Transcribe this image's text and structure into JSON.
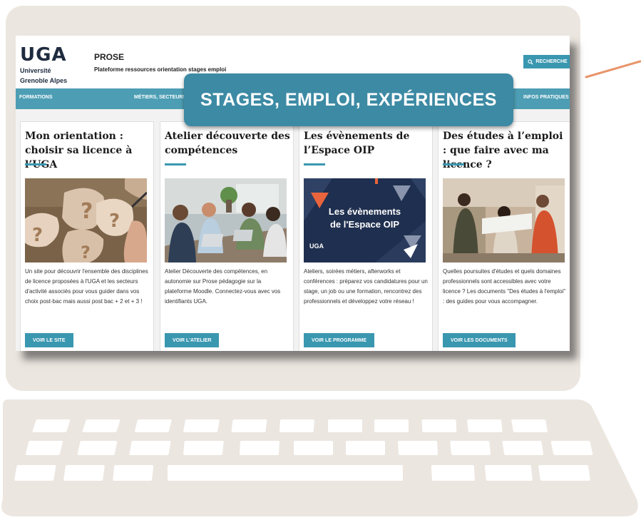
{
  "header": {
    "logo_text": "UGA",
    "logo_sub_1": "Université",
    "logo_sub_2": "Grenoble Alpes",
    "title": "PROSE",
    "subtitle": "Plateforme ressources orientation stages emploi",
    "search_label": "RECHERCHE"
  },
  "nav": {
    "items": [
      "FORMATIONS",
      "MÉTIERS, SECTEURS",
      "INFOS PRATIQUES"
    ]
  },
  "banner": {
    "text": "STAGES, EMPLOI, EXPÉRIENCES"
  },
  "cards": [
    {
      "title": "Mon orientation : choisir sa licence à l’UGA",
      "description": "Un site pour découvrir l'ensemble des disciplines de licence proposées à l'UGA et les secteurs d'activité associés pour vous guider dans vos choix post-bac mais aussi post bac + 2 et + 3 !",
      "button": "VOIR LE SITE"
    },
    {
      "title": "Atelier découverte des compétences",
      "description": "Atelier Découverte des compétences, en autonomie sur Prose pédagogie sur la plateforme Moodle. Connectez-vous avec vos identifiants UGA.",
      "button": "VOIR L'ATELIER"
    },
    {
      "title": "Les évènements de l’Espace OIP",
      "description": "Ateliers, soirées métiers, afterworks et conférences : préparez vos candidatures pour un stage, un job ou une formation, rencontrez des professionnels et développez votre réseau !",
      "button": "VOIR LE PROGRAMME",
      "image_text_1": "Les évènements",
      "image_text_2": "de l'Espace OIP",
      "image_logo": "UGA"
    },
    {
      "title": "Des études à l’emploi : que faire avec ma licence ?",
      "description": "Quelles poursuites d'études et quels domaines professionnels sont accessibles avec votre licence ? Les documents \"Des études à l'emploi\" : des guides pour vous accompagner.",
      "button": "VOIR LES DOCUMENTS"
    }
  ],
  "colors": {
    "accent": "#3a97b0",
    "navbar": "#4d9eb4",
    "banner": "#3d8aa4",
    "laptop": "#ece6e0",
    "arrow": "#e8956a",
    "logo_orange": "#e8643c"
  }
}
